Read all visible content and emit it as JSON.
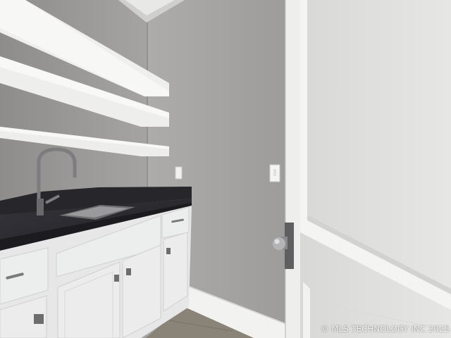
{
  "photo": {
    "watermark": "© MLS TECHNOLOGY INC 2025"
  },
  "colors": {
    "wall": "#a9a7a5",
    "wall_shadow": "#8e8c8a",
    "trim": "#f2f2f0",
    "cabinet": "#e8e9e8",
    "countertop": "#2b2b30",
    "floor": "#8a8378",
    "door": "#e3e3e2"
  }
}
